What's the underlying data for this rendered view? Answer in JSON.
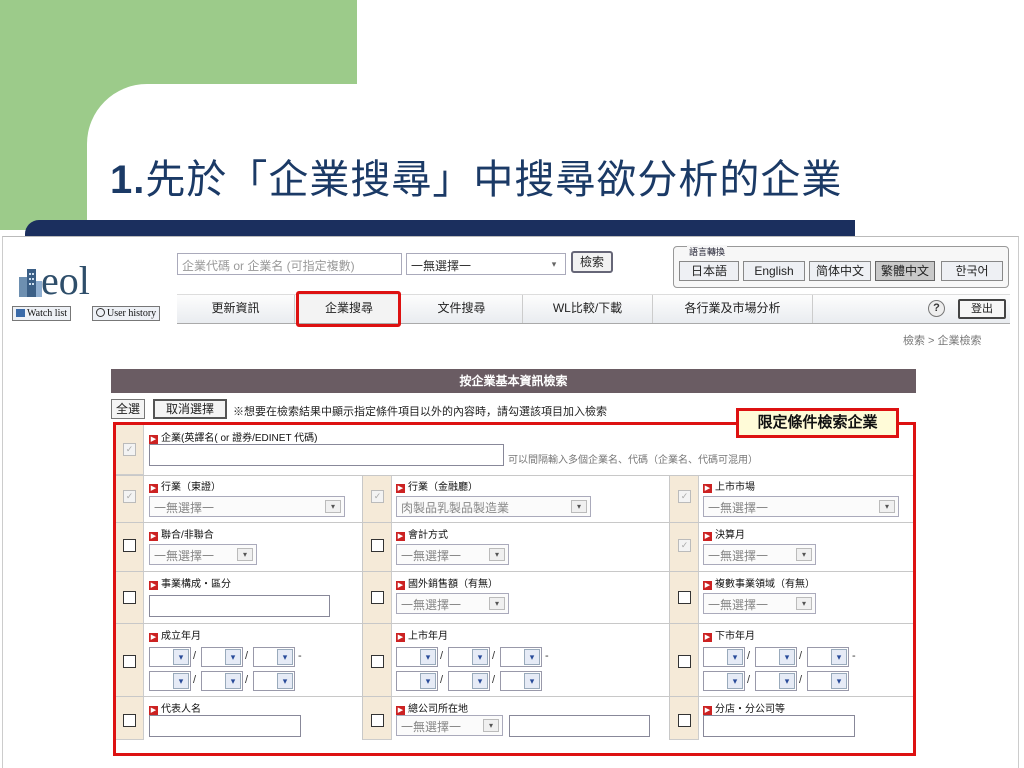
{
  "slide": {
    "title_number": "1.",
    "title_text": "先於「企業搜尋」中搜尋欲分析的企業"
  },
  "app": {
    "logo_text": "eol",
    "watch_list": "Watch list",
    "user_history": "User history",
    "search_placeholder": "企業代碼 or 企業名 (可指定複數)",
    "search_select_value": "一無選擇一",
    "search_button": "檢索",
    "language_label": "語言轉換",
    "languages": [
      "日本語",
      "English",
      "简体中文",
      "繁體中文",
      "한국어"
    ],
    "active_language": "繁體中文",
    "nav_items": [
      "更新資訊",
      "企業搜尋",
      "文件搜尋",
      "WL比較/下載",
      "各行業及市場分析"
    ],
    "active_nav": "企業搜尋",
    "help_label": "?",
    "logout_label": "登出",
    "breadcrumb": "檢索 > 企業檢索"
  },
  "panel": {
    "title": "按企業基本資訊檢索",
    "select_all": "全選",
    "deselect": "取消選擇",
    "hint": "※想要在檢索結果中顯示指定條件項目以外的內容時，請勾選該項目加入檢索",
    "callout": "限定條件檢索企業",
    "company_label": "企業(英譯名( or 證券/EDINET 代碼)",
    "company_hint": "可以間隔輸入多個企業名、代碼（企業名、代碼可混用）",
    "fields": {
      "industry_tse": {
        "label": "行業（東證）",
        "value": "一無選擇一"
      },
      "industry_fsa": {
        "label": "行業（金融廳）",
        "value": "肉製品乳製品製造業"
      },
      "listed_market": {
        "label": "上市市場",
        "value": "一無選擇一"
      },
      "consolidated": {
        "label": "聯合/非聯合",
        "value": "一無選擇一"
      },
      "accounting": {
        "label": "會計方式",
        "value": "一無選擇一"
      },
      "fiscal_month": {
        "label": "決算月",
        "value": "一無選擇一"
      },
      "segment": {
        "label": "事業構成・區分"
      },
      "overseas_sales": {
        "label": "國外銷售額（有無）",
        "value": "一無選擇一"
      },
      "multi_segment": {
        "label": "複數事業領域（有無）",
        "value": "一無選擇一"
      },
      "founded": {
        "label": "成立年月"
      },
      "listed_date": {
        "label": "上市年月"
      },
      "delisted_date": {
        "label": "下市年月"
      },
      "representative": {
        "label": "代表人名"
      },
      "hq_location": {
        "label": "總公司所在地",
        "value": "一無選擇一"
      },
      "branch": {
        "label": "分店・分公司等"
      }
    },
    "range_dash": "-"
  },
  "colors": {
    "green": "#9ccb8a",
    "navy": "#1b2f5e",
    "title": "#1b3a66",
    "highlight_red": "#dd1111",
    "panel_header": "#6a5c63"
  }
}
